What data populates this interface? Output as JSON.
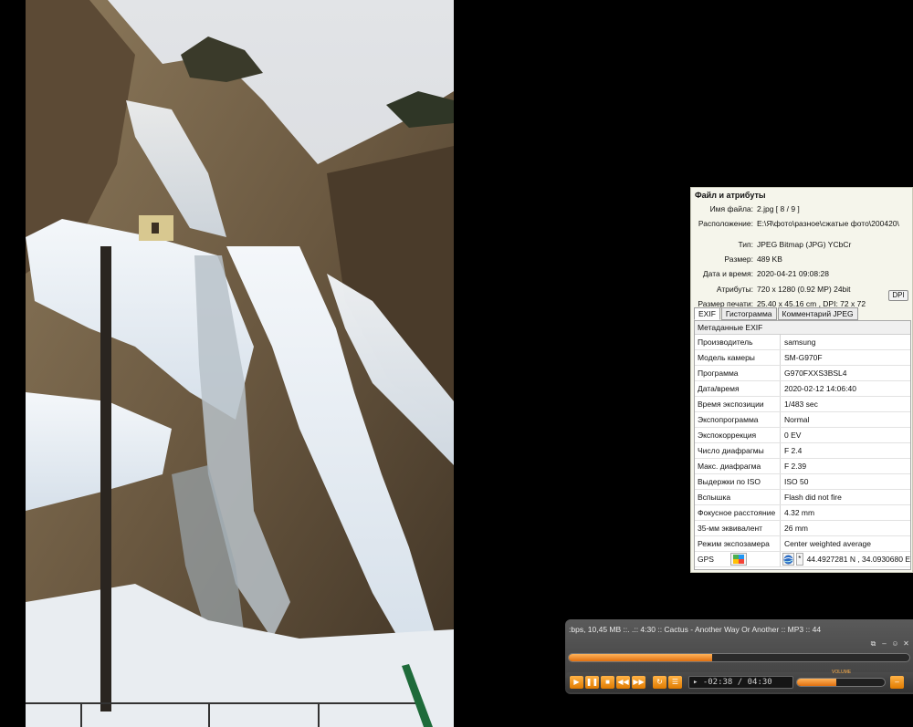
{
  "file_panel": {
    "title": "Файл и атрибуты",
    "rows": [
      {
        "key": "Имя файла:",
        "value": "2.jpg   [ 8 / 9 ]"
      },
      {
        "key": "Расположение:",
        "value": "E:\\Я\\фото\\разное\\сжатые фото\\200420\\"
      },
      {
        "key": "Тип:",
        "value": "JPEG Bitmap (JPG) YCbCr"
      },
      {
        "key": "Размер:",
        "value": "489 KB"
      },
      {
        "key": "Дата и время:",
        "value": "2020-04-21 09:08:28"
      },
      {
        "key": "Атрибуты:",
        "value": "720 x 1280 (0.92 MP)  24bit"
      },
      {
        "key": "Размер печати:",
        "value": "25.40 x 45.16 cm ,  DPI: 72 x 72"
      }
    ],
    "dpi_button": "DPI"
  },
  "tabs": [
    {
      "label": "EXIF",
      "active": true
    },
    {
      "label": "Гистограмма",
      "active": false
    },
    {
      "label": "Комментарий JPEG",
      "active": false
    }
  ],
  "exif": {
    "header": "Метаданные EXIF",
    "rows": [
      {
        "key": "Производитель",
        "value": "samsung"
      },
      {
        "key": "Модель камеры",
        "value": "SM-G970F"
      },
      {
        "key": "Программа",
        "value": "G970FXXS3BSL4"
      },
      {
        "key": "Дата/время",
        "value": "2020-02-12 14:06:40"
      },
      {
        "key": "Время экспозиции",
        "value": "1/483 sec"
      },
      {
        "key": "Экспопрограмма",
        "value": "Normal"
      },
      {
        "key": "Экспокоррекция",
        "value": "0 EV"
      },
      {
        "key": "Число диафрагмы",
        "value": "F 2.4"
      },
      {
        "key": "Макс. диафрагма",
        "value": "F 2.39"
      },
      {
        "key": "Выдержки по ISO",
        "value": "ISO 50"
      },
      {
        "key": "Вспышка",
        "value": "Flash did not fire"
      },
      {
        "key": "Фокусное расстояние",
        "value": "4.32 mm"
      },
      {
        "key": "35-мм эквивалент",
        "value": "26 mm"
      },
      {
        "key": "Режим экспозамера",
        "value": "Center weighted average"
      }
    ],
    "gps": {
      "key": "GPS",
      "value": "44.4927281 N  ,  34.0930680 E",
      "star": "*"
    }
  },
  "player": {
    "ticker": ":bps, 10,45 MB ::.      .:: 4:30 :: Cactus - Another Way Or Another :: MP3 :: 44",
    "progress": 0.42,
    "volume": 0.45,
    "volume_label": "VOLUME",
    "time": "▸ -02:38 / 04:30",
    "win_buttons": [
      "⧉",
      "–",
      "☺",
      "✕"
    ],
    "buttons": [
      "▶",
      "❚❚",
      "■",
      "◀◀",
      "▶▶",
      "↻",
      "☰"
    ],
    "eject": "–"
  },
  "colors": {
    "accent": "#f08a1c",
    "panel_bg": "#f5f5eb"
  }
}
